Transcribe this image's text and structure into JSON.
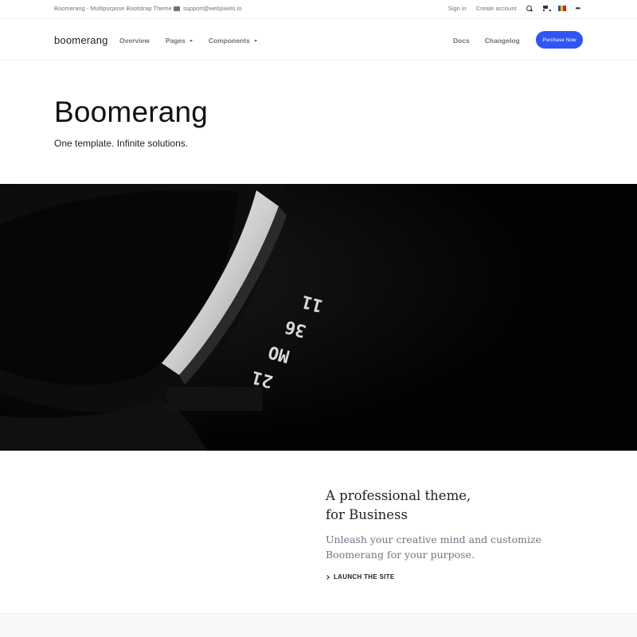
{
  "topbar": {
    "title": "Boomerang - Multipurpose Bootstrap Theme",
    "email": "support@webpixels.io",
    "sign_in": "Sign in",
    "create_account": "Create account",
    "icons": [
      "envelope-icon",
      "search-icon",
      "cart-icon",
      "flag-icon",
      "more-icon"
    ],
    "more": "•••"
  },
  "navbar": {
    "logo": "boomerang",
    "left_items": [
      {
        "label": "Overview",
        "has_caret": false
      },
      {
        "label": "Pages",
        "has_caret": true
      },
      {
        "label": "Components",
        "has_caret": true
      }
    ],
    "right_items": [
      {
        "label": "Docs"
      },
      {
        "label": "Changelog"
      }
    ],
    "cta_label": "Purchase Now",
    "cta_color": "#2f55f5"
  },
  "hero": {
    "title": "Boomerang",
    "subtitle": "One template. Infinite solutions."
  },
  "image_band": {
    "text_lines": [
      "21",
      "MO",
      "36",
      "11"
    ]
  },
  "feature": {
    "title_line1": "A professional theme,",
    "title_line2": "for Business",
    "text_line1": "Unleash your creative mind and customize",
    "text_line2": "Boomerang for your purpose.",
    "link_label": "LAUNCH THE SITE"
  },
  "colors": {
    "accent": "#2f55f5",
    "muted_text": "#6c757d",
    "band_background": "#040404"
  }
}
